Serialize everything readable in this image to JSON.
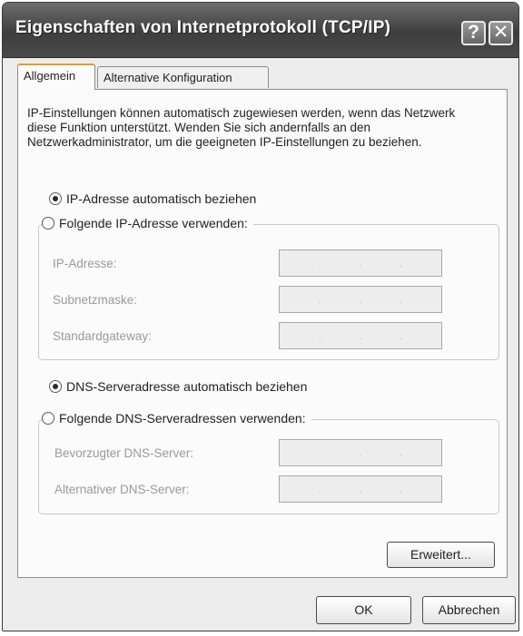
{
  "window": {
    "title": "Eigenschaften von Internetprotokoll (TCP/IP)",
    "help_label": "?",
    "close_label": "✕"
  },
  "tabs": [
    {
      "label": "Allgemein",
      "active": true
    },
    {
      "label": "Alternative Konfiguration",
      "active": false
    }
  ],
  "intro_text": "IP-Einstellungen können automatisch zugewiesen werden, wenn das Netzwerk diese Funktion unterstützt. Wenden Sie sich andernfalls an den Netzwerkadministrator, um die geeigneten IP-Einstellungen zu beziehen.",
  "ip": {
    "auto_label": "IP-Adresse automatisch beziehen",
    "manual_label": "Folgende IP-Adresse verwenden:",
    "selected": "auto",
    "fields": [
      {
        "label": "IP-Adresse:",
        "value": ""
      },
      {
        "label": "Subnetzmaske:",
        "value": ""
      },
      {
        "label": "Standardgateway:",
        "value": ""
      }
    ]
  },
  "dns": {
    "auto_label": "DNS-Serveradresse automatisch beziehen",
    "manual_label": "Folgende DNS-Serveradressen verwenden:",
    "selected": "auto",
    "fields": [
      {
        "label": "Bevorzugter DNS-Server:",
        "value": ""
      },
      {
        "label": "Alternativer DNS-Server:",
        "value": ""
      }
    ]
  },
  "buttons": {
    "advanced": "Erweitert...",
    "ok": "OK",
    "cancel": "Abbrechen"
  },
  "ip_separator": "."
}
